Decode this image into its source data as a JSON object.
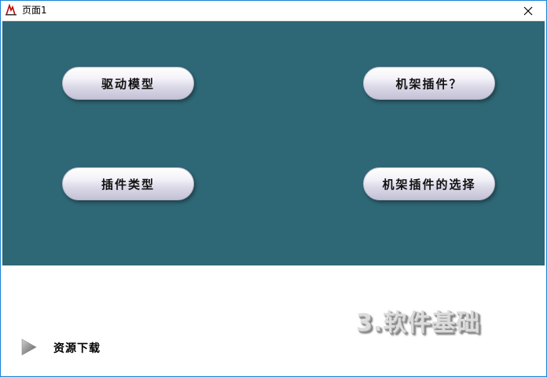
{
  "window": {
    "title": "页面1"
  },
  "buttons": {
    "drive_model": "驱动模型",
    "rack_plugin_q": "机架插件？",
    "plugin_types": "插件类型",
    "rack_plugin_choice": "机架插件的选择"
  },
  "footer": {
    "logo_text": "3.软件基础",
    "download_label": "资源下载"
  },
  "colors": {
    "panel_background": "#2e6775",
    "window_border": "#1883d7"
  },
  "icons": {
    "app": "app-logo-icon",
    "close": "close-icon",
    "arrow": "play-arrow-icon"
  }
}
